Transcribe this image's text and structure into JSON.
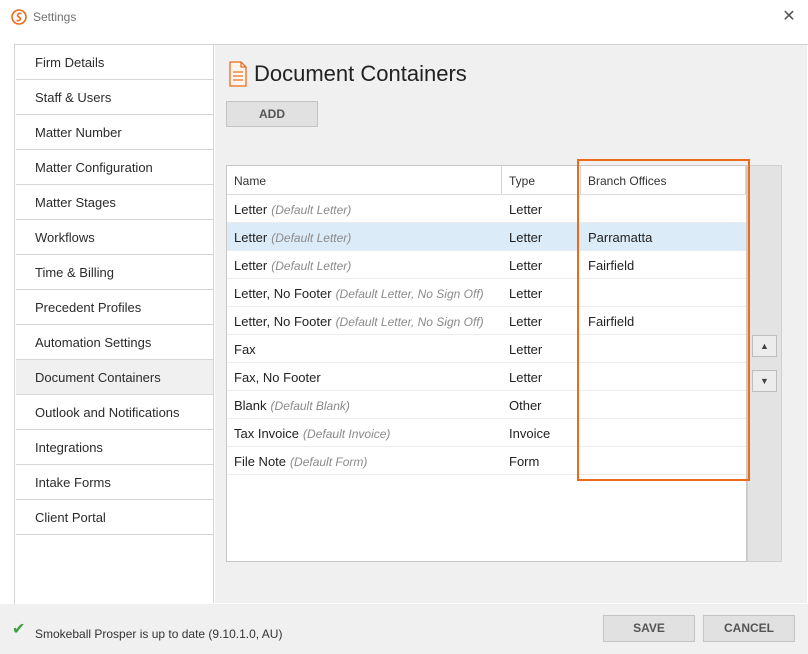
{
  "window": {
    "title": "Settings",
    "close_glyph": "✕",
    "logo_icon": "smokeball-logo",
    "accent_color": "#ea6b1c"
  },
  "sidebar": {
    "items": [
      {
        "label": "Firm Details"
      },
      {
        "label": "Staff & Users"
      },
      {
        "label": "Matter Number"
      },
      {
        "label": "Matter Configuration"
      },
      {
        "label": "Matter Stages"
      },
      {
        "label": "Workflows"
      },
      {
        "label": "Time & Billing"
      },
      {
        "label": "Precedent Profiles"
      },
      {
        "label": "Automation Settings"
      },
      {
        "label": "Document Containers"
      },
      {
        "label": "Outlook and Notifications"
      },
      {
        "label": "Integrations"
      },
      {
        "label": "Intake Forms"
      },
      {
        "label": "Client Portal"
      }
    ],
    "active_index": 9
  },
  "main": {
    "title": "Document Containers",
    "title_icon": "document-icon",
    "add_label": "ADD",
    "table": {
      "columns": [
        "Name",
        "Type",
        "Branch Offices"
      ],
      "rows": [
        {
          "name": "Letter",
          "default": "(Default Letter)",
          "type": "Letter",
          "branch": ""
        },
        {
          "name": "Letter",
          "default": "(Default Letter)",
          "type": "Letter",
          "branch": "Parramatta"
        },
        {
          "name": "Letter",
          "default": "(Default Letter)",
          "type": "Letter",
          "branch": "Fairfield"
        },
        {
          "name": "Letter, No Footer",
          "default": "(Default Letter, No Sign Off)",
          "type": "Letter",
          "branch": ""
        },
        {
          "name": "Letter, No Footer",
          "default": "(Default Letter, No Sign Off)",
          "type": "Letter",
          "branch": "Fairfield"
        },
        {
          "name": "Fax",
          "default": "",
          "type": "Letter",
          "branch": ""
        },
        {
          "name": "Fax, No Footer",
          "default": "",
          "type": "Letter",
          "branch": ""
        },
        {
          "name": "Blank",
          "default": "(Default Blank)",
          "type": "Other",
          "branch": ""
        },
        {
          "name": "Tax Invoice",
          "default": "(Default Invoice)",
          "type": "Invoice",
          "branch": ""
        },
        {
          "name": "File Note",
          "default": "(Default Form)",
          "type": "Form",
          "branch": ""
        }
      ],
      "selected_row": 1
    },
    "move_up_glyph": "▲",
    "move_down_glyph": "▼"
  },
  "footer": {
    "status_icon": "checkmark-icon",
    "status_glyph": "✔",
    "status_text": "Smokeball Prosper is up to date (9.10.1.0, AU)",
    "save_label": "SAVE",
    "cancel_label": "CANCEL"
  }
}
